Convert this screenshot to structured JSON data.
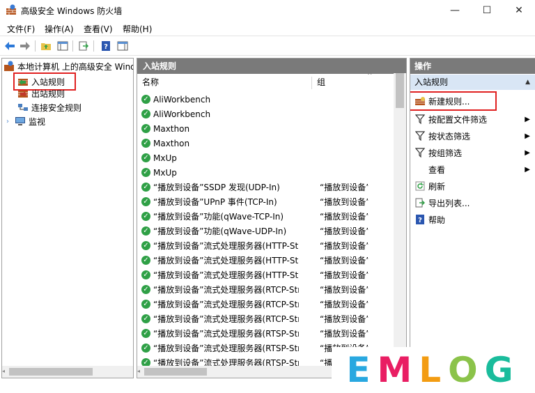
{
  "window": {
    "title": "高级安全 Windows 防火墙",
    "minimize": "—",
    "maximize": "☐",
    "close": "✕"
  },
  "menu": [
    "文件(F)",
    "操作(A)",
    "查看(V)",
    "帮助(H)"
  ],
  "tree": {
    "root": "本地计算机 上的高级安全 Windows",
    "items": [
      "入站规则",
      "出站规则",
      "连接安全规则",
      "监视"
    ]
  },
  "main": {
    "header": "入站规则",
    "columns": {
      "name": "名称",
      "group": "组"
    },
    "rows": [
      {
        "name": "AliWorkbench",
        "group": ""
      },
      {
        "name": "AliWorkbench",
        "group": ""
      },
      {
        "name": "Maxthon",
        "group": ""
      },
      {
        "name": "Maxthon",
        "group": ""
      },
      {
        "name": "MxUp",
        "group": ""
      },
      {
        "name": "MxUp",
        "group": ""
      },
      {
        "name": "“播放到设备”SSDP 发现(UDP-In)",
        "group": "“播放到设备”功能"
      },
      {
        "name": "“播放到设备”UPnP 事件(TCP-In)",
        "group": "“播放到设备”功能"
      },
      {
        "name": "“播放到设备”功能(qWave-TCP-In)",
        "group": "“播放到设备”功能"
      },
      {
        "name": "“播放到设备”功能(qWave-UDP-In)",
        "group": "“播放到设备”功能"
      },
      {
        "name": "“播放到设备”流式处理服务器(HTTP-Stre...",
        "group": "“播放到设备”功能"
      },
      {
        "name": "“播放到设备”流式处理服务器(HTTP-Stre...",
        "group": "“播放到设备”功能"
      },
      {
        "name": "“播放到设备”流式处理服务器(HTTP-Stre...",
        "group": "“播放到设备”功能"
      },
      {
        "name": "“播放到设备”流式处理服务器(RTCP-Stre...",
        "group": "“播放到设备”功能"
      },
      {
        "name": "“播放到设备”流式处理服务器(RTCP-Stre...",
        "group": "“播放到设备”功能"
      },
      {
        "name": "“播放到设备”流式处理服务器(RTCP-Stre...",
        "group": "“播放到设备”功能"
      },
      {
        "name": "“播放到设备”流式处理服务器(RTSP-Stre...",
        "group": "“播放到设备”功能"
      },
      {
        "name": "“播放到设备”流式处理服务器(RTSP-Stre...",
        "group": "“播放到设备”功能"
      },
      {
        "name": "“播放到设备”流式处理服务器(RTSP-Stre...",
        "group": "“播放到设备”功能"
      }
    ]
  },
  "actions": {
    "header": "操作",
    "section": "入站规则",
    "items": [
      "新建规则...",
      "按配置文件筛选",
      "按状态筛选",
      "按组筛选",
      "查看",
      "刷新",
      "导出列表...",
      "帮助"
    ]
  },
  "watermark": "EMLOG",
  "colors": {
    "accent_red": "#e02020",
    "check_green": "#2fa046",
    "header_gray": "#7a7a7a"
  }
}
